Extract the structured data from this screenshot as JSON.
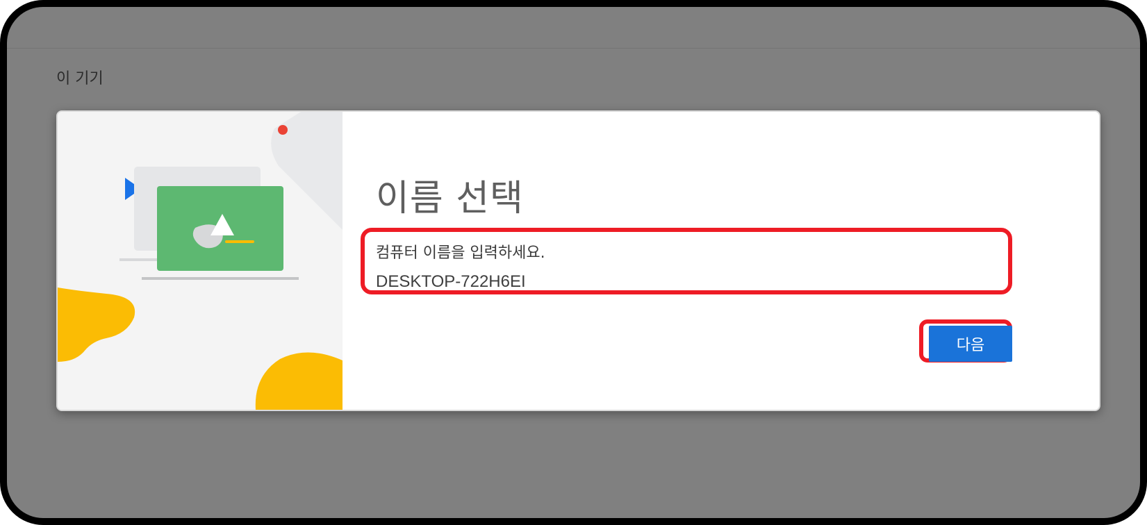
{
  "page": {
    "title": "이 기기"
  },
  "dialog": {
    "heading": "이름 선택",
    "name_field": {
      "label": "컴퓨터 이름을 입력하세요.",
      "value": "DESKTOP-722H6EI"
    },
    "next_button": "다음"
  },
  "colors": {
    "accent": "#1a73d9",
    "highlight": "#ee1c25",
    "backdrop": "#808080"
  }
}
